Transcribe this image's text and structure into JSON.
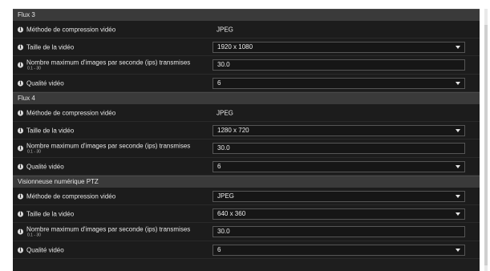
{
  "sections": [
    {
      "title": "Flux 3",
      "compression": {
        "label": "Méthode de compression vidéo",
        "value": "JPEG"
      },
      "size": {
        "label": "Taille de la vidéo",
        "value": "1920 x 1080"
      },
      "fps": {
        "label": "Nombre maximum d'images par seconde (ips) transmises",
        "range": "0.1 - 30",
        "value": "30.0"
      },
      "quality": {
        "label": "Qualité vidéo",
        "value": "6"
      }
    },
    {
      "title": "Flux 4",
      "compression": {
        "label": "Méthode de compression vidéo",
        "value": "JPEG"
      },
      "size": {
        "label": "Taille de la vidéo",
        "value": "1280 x 720"
      },
      "fps": {
        "label": "Nombre maximum d'images par seconde (ips) transmises",
        "range": "0.1 - 30",
        "value": "30.0"
      },
      "quality": {
        "label": "Qualité vidéo",
        "value": "6"
      }
    },
    {
      "title": "Visionneuse numérique PTZ",
      "compression": {
        "label": "Méthode de compression vidéo",
        "value": "JPEG"
      },
      "size": {
        "label": "Taille de la vidéo",
        "value": "640 x 360"
      },
      "fps": {
        "label": "Nombre maximum d'images par seconde (ips) transmises",
        "range": "0.1 - 30",
        "value": "30.0"
      },
      "quality": {
        "label": "Qualité vidéo",
        "value": "6"
      }
    }
  ]
}
